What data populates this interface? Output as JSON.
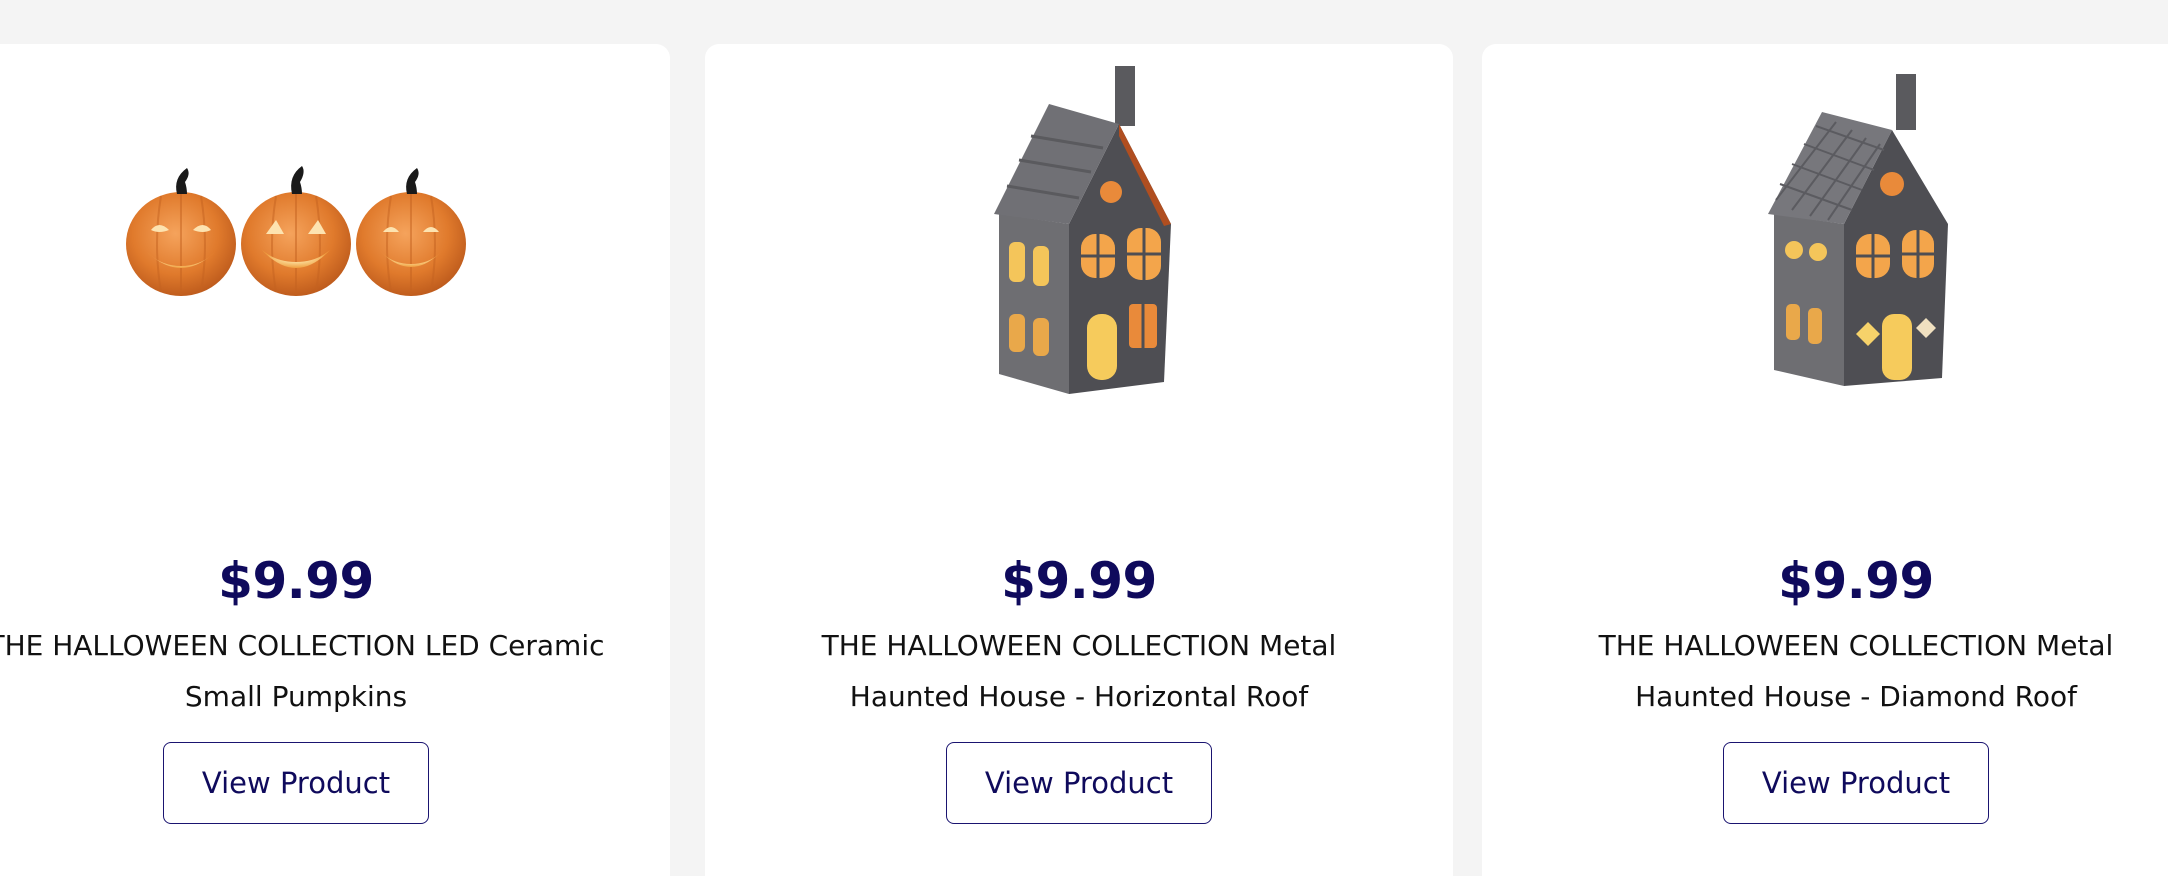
{
  "colors": {
    "page_background": "#f4f4f4",
    "card_background": "#ffffff",
    "price_color": "#0f0a5c",
    "button_border": "#1a1470",
    "title_color": "#111111"
  },
  "products": [
    {
      "image_icon": "ceramic-pumpkins-image",
      "price": "$9.99",
      "title": "THE HALLOWEEN COLLECTION LED Ceramic Small Pumpkins",
      "button_label": "View Product"
    },
    {
      "image_icon": "haunted-house-horizontal-roof-image",
      "price": "$9.99",
      "title": "THE HALLOWEEN COLLECTION Metal Haunted House - Horizontal Roof",
      "button_label": "View Product"
    },
    {
      "image_icon": "haunted-house-diamond-roof-image",
      "price": "$9.99",
      "title": "THE HALLOWEEN COLLECTION Metal Haunted House - Diamond Roof",
      "button_label": "View Product"
    }
  ]
}
